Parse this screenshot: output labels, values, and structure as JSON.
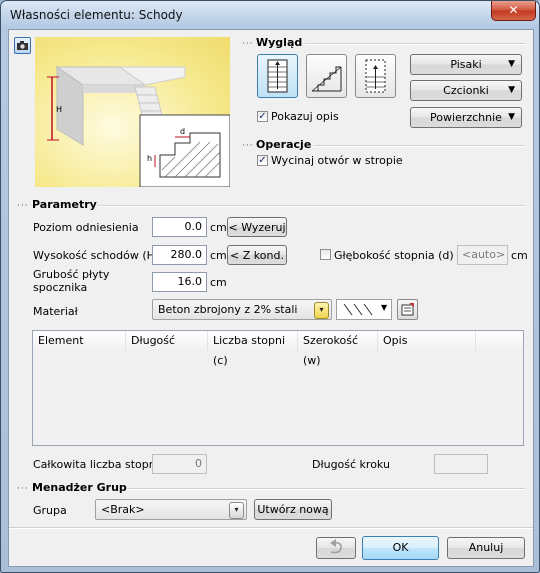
{
  "window": {
    "title": "Własności elementu: Schody",
    "close_glyph": "✕"
  },
  "wyglad": {
    "label": "Wygląd",
    "show_desc_label": "Pokazuj opis",
    "show_desc_checked": "✓",
    "btn_pisaki": "Pisaki",
    "btn_czcionki": "Czcionki",
    "btn_powierzchnie": "Powierzchnie"
  },
  "operacje": {
    "label": "Operacje",
    "cut_label": "Wycinaj otwór w stropie",
    "cut_checked": "✓"
  },
  "preview": {
    "label_h": "H",
    "label_h_small": "h",
    "label_d": "d"
  },
  "parametry": {
    "label": "Parametry",
    "poziom_label": "Poziom odniesienia",
    "poziom_value": "0.0",
    "poziom_unit": "cm",
    "poziom_btn": "< Wyzeruj",
    "wysokosc_label": "Wysokość schodów (H)",
    "wysokosc_value": "280.0",
    "wysokosc_unit": "cm",
    "wysokosc_btn": "< Z kond.",
    "glebokosc_label": "Głębokość stopnia (d)",
    "glebokosc_value": "<auto>",
    "glebokosc_unit": "cm",
    "grubosc_label_line1": "Grubość płyty",
    "grubosc_label_line2": "spocznika",
    "grubosc_value": "16.0",
    "grubosc_unit": "cm",
    "material_label": "Materiał",
    "material_value": "Beton zbrojony z 2% stali"
  },
  "table": {
    "columns": [
      "Element",
      "Długość",
      "Liczba stopni (c)",
      "Szerokość (w)",
      "Opis"
    ]
  },
  "summary": {
    "total_steps_label": "Całkowita liczba stopni",
    "total_steps_value": "0",
    "step_length_label": "Długość kroku",
    "step_length_value": ""
  },
  "menadzer": {
    "label": "Menadżer Grup",
    "grupa_label": "Grupa",
    "grupa_value": "<Brak>",
    "create_btn": "Utwórz nową"
  },
  "footer": {
    "ok": "OK",
    "cancel": "Anuluj"
  }
}
